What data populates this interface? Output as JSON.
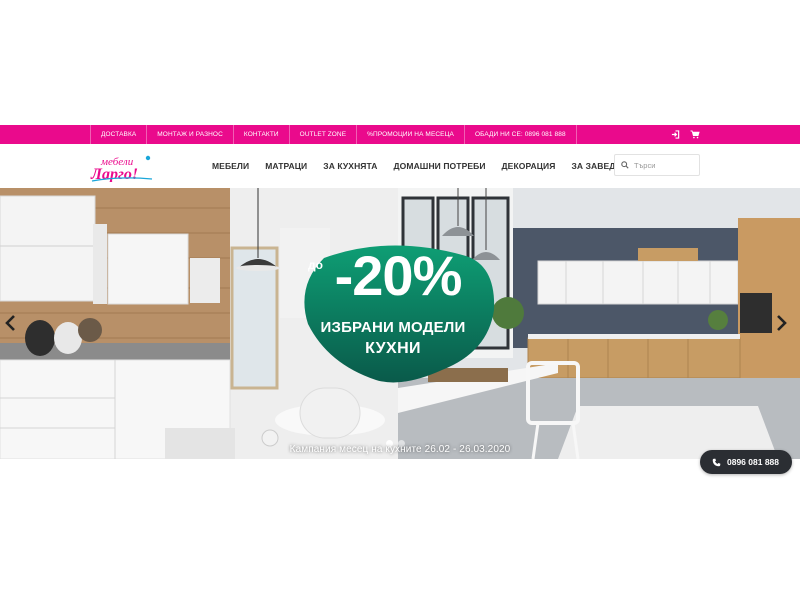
{
  "topbar": {
    "links": [
      "ДОСТАВКА",
      "МОНТАЖ И РАЗНОС",
      "КОНТАКТИ",
      "OUTLET ZONE",
      "%ПРОМОЦИИ НА МЕСЕЦА",
      "ОБАДИ НИ СЕ: 0896 081 888"
    ],
    "icons": [
      "login-icon",
      "cart-icon"
    ],
    "color": "#ea0a8c"
  },
  "header": {
    "logo_text": "мебели Ларго!",
    "nav": [
      "МЕБЕЛИ",
      "МАТРАЦИ",
      "ЗА КУХНЯТА",
      "ДОМАШНИ ПОТРЕБИ",
      "ДЕКОРАЦИЯ",
      "ЗА ЗАВЕДЕНИЯ"
    ],
    "search_placeholder": "Търси"
  },
  "hero": {
    "promo_prefix": "до",
    "promo_percent": "-20%",
    "promo_line1": "ИЗБРАНИ МОДЕЛИ",
    "promo_line2": "КУХНИ",
    "caption": "Кампания месец на кухните 26.02 - 26.03.2020",
    "slide_count": 2,
    "active_slide": 1,
    "promo_color": "#0e9e74"
  },
  "phone": {
    "number": "0896 081 888"
  }
}
